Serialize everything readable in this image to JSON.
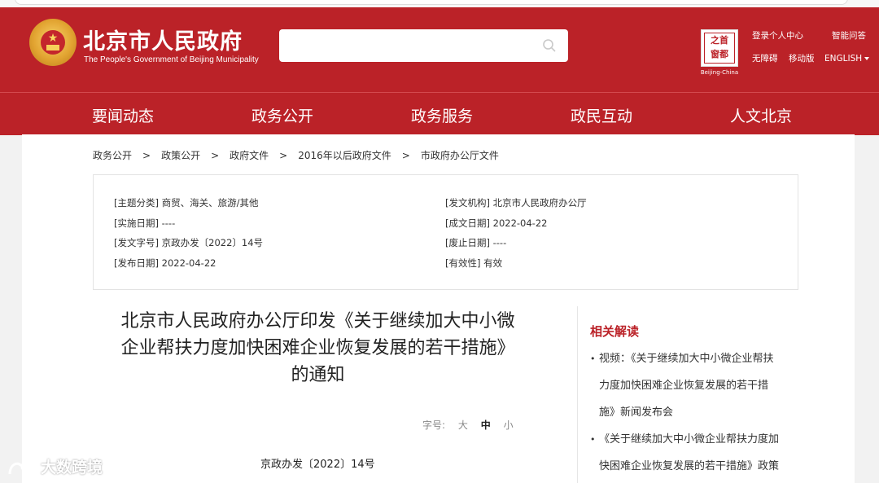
{
  "header": {
    "title": "北京市人民政府",
    "subtitle": "The People's Government of Beijing Municipality",
    "search_placeholder": "",
    "seal_text": [
      "首",
      "都",
      "之",
      "窗"
    ],
    "seal_caption": "Beijing-China",
    "links": {
      "login": "登录个人中心",
      "smart_qa": "智能问答",
      "accessible": "无障碍",
      "mobile": "移动版",
      "english": "ENGLISH"
    }
  },
  "nav": [
    "要闻动态",
    "政务公开",
    "政务服务",
    "政民互动",
    "人文北京"
  ],
  "breadcrumb": [
    "政务公开",
    "政策公开",
    "政府文件",
    "2016年以后政府文件",
    "市政府办公厅文件"
  ],
  "breadcrumb_sep": ">",
  "meta": {
    "left": [
      "[主题分类] 商贸、海关、旅游/其他",
      "[实施日期] ----",
      "[发文字号] 京政办发〔2022〕14号",
      "[发布日期] 2022-04-22"
    ],
    "right": [
      "[发文机构] 北京市人民政府办公厅",
      "[成文日期] 2022-04-22",
      "[废止日期] ----",
      "[有效性] 有效"
    ]
  },
  "document": {
    "title_lines": [
      "北京市人民政府办公厅印发《关于继续加大中小微",
      "企业帮扶力度加快困难企业恢复发展的若干措施》",
      "的通知"
    ],
    "font_size_label": "字号:",
    "font_sizes": [
      "大",
      "中",
      "小"
    ],
    "font_size_selected": "中",
    "doc_number": "京政办发〔2022〕14号"
  },
  "sidebar": {
    "title": "相关解读",
    "items": [
      [
        "视频：《关于继续加大中小微企业帮扶",
        "力度加快困难企业恢复发展的若干措",
        "施》新闻发布会"
      ],
      [
        "《关于继续加大中小微企业帮扶力度加",
        "快困难企业恢复发展的若干措施》政策"
      ]
    ]
  },
  "watermark": "大数跨境",
  "colors": {
    "brand_red": "#bb2228",
    "gold": "#e2a431"
  }
}
